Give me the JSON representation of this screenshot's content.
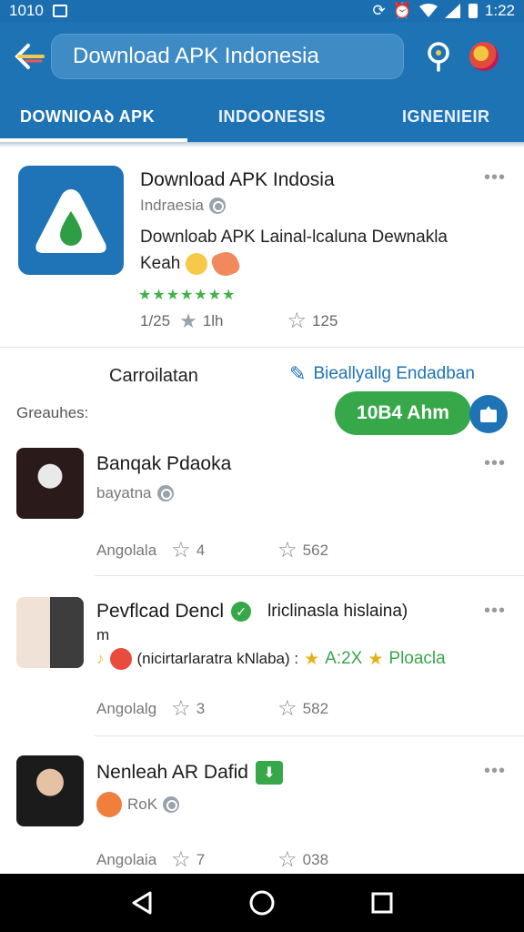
{
  "status_bar": {
    "time_left": "1010",
    "time_right": "1:22"
  },
  "search": {
    "text": "Download APK Indonesia"
  },
  "tabs": [
    {
      "label": "DOWNIOAꝺ APK"
    },
    {
      "label": "INDOONESIS"
    },
    {
      "label": "IGNENIEIR"
    }
  ],
  "featured": {
    "title": "Download APK Indosia",
    "subtitle": "Indraesia",
    "description_line1": "Downloab APK Lainal-lcaluna Dewnakla",
    "description_line2": "Keah",
    "stars": "★★★★★★★",
    "date": "1/25",
    "meta_time": "1lh",
    "likes": "125",
    "more": "•••"
  },
  "compilation": {
    "title": "Carroilatan",
    "link": "Bieallyallg Endadban",
    "label": "Greauhes:",
    "button": "10B4 Ahm"
  },
  "items": [
    {
      "title": "Banqak Pdaoka",
      "subtitle": "bayatna",
      "meta_label": "Angolala",
      "star_count": "4",
      "like_count": "562",
      "more": "•••"
    },
    {
      "title": "Pevflcad Dencl",
      "title_extra": "lriclinasla hislaina)",
      "title_cont": "m",
      "subtitle": "(nicirtarlaratra kNlaba) :",
      "rating": "A:2X",
      "rating_label": "Ploacla",
      "meta_label": "Angolalg",
      "star_count": "3",
      "like_count": "582",
      "more": "•••"
    },
    {
      "title": "Nenleah AR Dafid",
      "subtitle": "RoK",
      "meta_label": "Angolaia",
      "star_count": "7",
      "like_count": "038",
      "more": "•••"
    }
  ],
  "colors": {
    "primary": "#1e73b5",
    "accent_green": "#36a84a"
  }
}
